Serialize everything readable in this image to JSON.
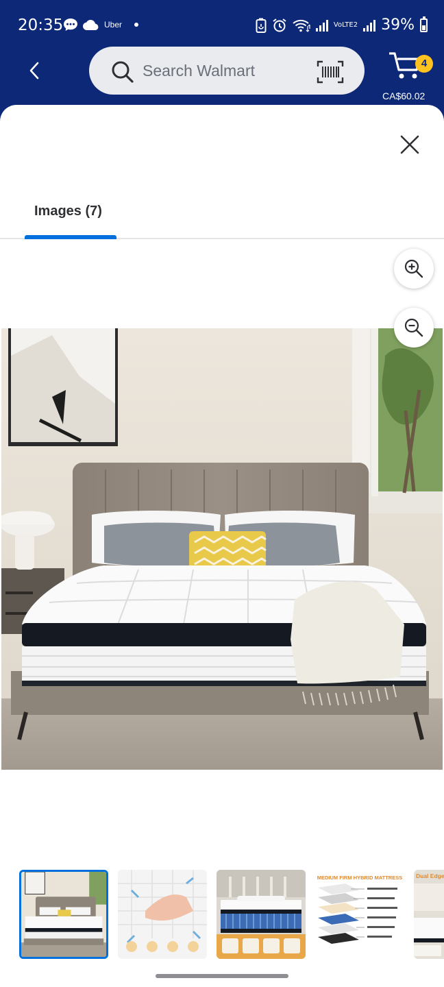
{
  "status_bar": {
    "time": "20:35",
    "notification_app": "Uber",
    "network": "VoLTE2",
    "battery": "39%",
    "icons": [
      "chat-icon",
      "cloud-icon",
      "uber-icon",
      "battery-saver-icon",
      "alarm-icon",
      "wifi-icon",
      "signal-icon",
      "battery-icon"
    ]
  },
  "header": {
    "back_icon": "chevron-left-icon",
    "search_placeholder": "Search Walmart",
    "cart": {
      "count": "4",
      "total": "CA$60.02"
    },
    "colors": {
      "brand_blue": "#0d2877",
      "badge_yellow": "#ffc220"
    }
  },
  "modal": {
    "close_icon": "close-icon",
    "tabs": [
      {
        "label": "Images (7)",
        "active": true
      }
    ],
    "accent": "#0071dc",
    "zoom": {
      "in_icon": "zoom-in-icon",
      "out_icon": "zoom-out-icon"
    },
    "main_image": {
      "subject": "mattress-photo",
      "selected_index": 0
    },
    "thumbnails": [
      {
        "subject": "bedroom-mattress",
        "selected": true
      },
      {
        "subject": "mattress-features"
      },
      {
        "subject": "mattress-in-use"
      },
      {
        "subject": "mattress-layers",
        "caption": "MEDIUM FIRM HYBRID MATTRESS"
      },
      {
        "subject": "dual-edge-support",
        "caption": "Dual Edge Su"
      }
    ]
  }
}
